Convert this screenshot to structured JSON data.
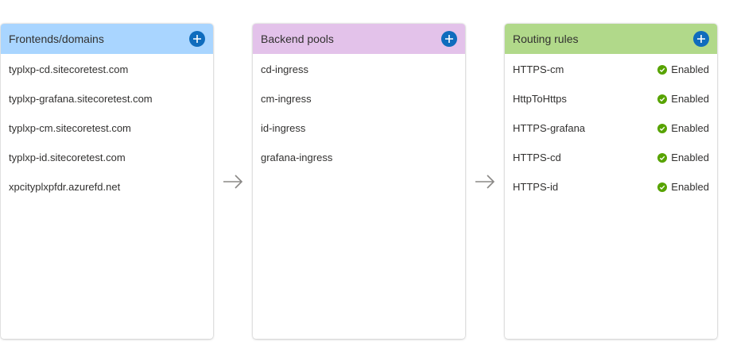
{
  "colors": {
    "frontends_header": "#a9d5ff",
    "backend_header": "#e3c2ea",
    "routing_header": "#b1d98a",
    "add_button": "#0f6cbd",
    "enabled_check": "#57a300",
    "arrow": "#8a8886"
  },
  "frontends": {
    "title": "Frontends/domains",
    "add_icon": "plus-circle-icon",
    "items": [
      {
        "label": "typlxp-cd.sitecoretest.com"
      },
      {
        "label": "typlxp-grafana.sitecoretest.com"
      },
      {
        "label": "typlxp-cm.sitecoretest.com"
      },
      {
        "label": "typlxp-id.sitecoretest.com"
      },
      {
        "label": "xpcityplxpfdr.azurefd.net"
      }
    ]
  },
  "backend_pools": {
    "title": "Backend pools",
    "add_icon": "plus-circle-icon",
    "items": [
      {
        "label": "cd-ingress"
      },
      {
        "label": "cm-ingress"
      },
      {
        "label": "id-ingress"
      },
      {
        "label": "grafana-ingress"
      }
    ]
  },
  "routing_rules": {
    "title": "Routing rules",
    "add_icon": "plus-circle-icon",
    "status_icon": "check-circle-icon",
    "items": [
      {
        "label": "HTTPS-cm",
        "status": "Enabled"
      },
      {
        "label": "HttpToHttps",
        "status": "Enabled"
      },
      {
        "label": "HTTPS-grafana",
        "status": "Enabled"
      },
      {
        "label": "HTTPS-cd",
        "status": "Enabled"
      },
      {
        "label": "HTTPS-id",
        "status": "Enabled"
      }
    ]
  },
  "connectors": {
    "icon": "arrow-right-icon"
  }
}
